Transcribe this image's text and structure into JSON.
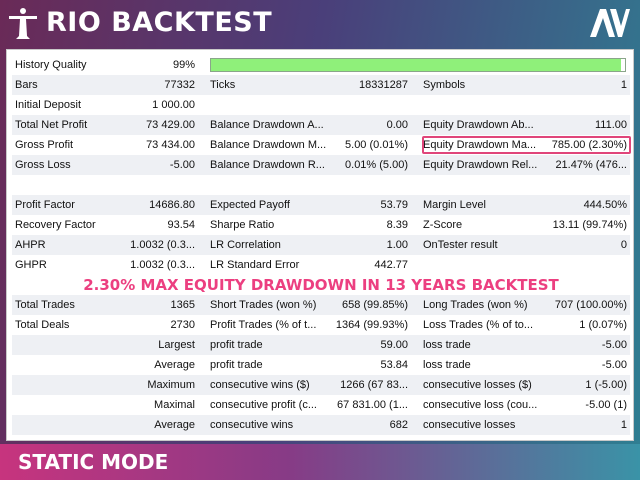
{
  "header": {
    "title": "RIO BACKTEST",
    "logo_text": "AV",
    "colors": {
      "accent": "#ec3f80",
      "bar_fill": "#8ff07a"
    }
  },
  "report": {
    "history_quality": {
      "label": "History Quality",
      "value": "99%",
      "fill_percent": 99
    },
    "rows": [
      {
        "c1": {
          "label": "Bars",
          "value": "77332"
        },
        "c2": {
          "label": "Ticks",
          "value": "18331287"
        },
        "c3": {
          "label": "Symbols",
          "value": "1"
        }
      },
      {
        "c1": {
          "label": "Initial Deposit",
          "value": "1 000.00"
        },
        "c2": {
          "label": "",
          "value": ""
        },
        "c3": {
          "label": "",
          "value": ""
        }
      },
      {
        "c1": {
          "label": "Total Net Profit",
          "value": "73 429.00"
        },
        "c2": {
          "label": "Balance Drawdown A...",
          "value": "0.00"
        },
        "c3": {
          "label": "Equity Drawdown Ab...",
          "value": "111.00"
        }
      },
      {
        "c1": {
          "label": "Gross Profit",
          "value": "73 434.00"
        },
        "c2": {
          "label": "Balance Drawdown M...",
          "value": "5.00 (0.01%)"
        },
        "c3": {
          "label": "Equity Drawdown Ma...",
          "value": "785.00 (2.30%)"
        }
      },
      {
        "c1": {
          "label": "Gross Loss",
          "value": "-5.00"
        },
        "c2": {
          "label": "Balance Drawdown R...",
          "value": "0.01% (5.00)"
        },
        "c3": {
          "label": "Equity Drawdown Rel...",
          "value": "21.47% (476..."
        }
      },
      {
        "c1": {
          "label": "",
          "value": ""
        },
        "c2": {
          "label": "",
          "value": ""
        },
        "c3": {
          "label": "",
          "value": ""
        }
      },
      {
        "c1": {
          "label": "Profit Factor",
          "value": "14686.80"
        },
        "c2": {
          "label": "Expected Payoff",
          "value": "53.79"
        },
        "c3": {
          "label": "Margin Level",
          "value": "444.50%"
        }
      },
      {
        "c1": {
          "label": "Recovery Factor",
          "value": "93.54"
        },
        "c2": {
          "label": "Sharpe Ratio",
          "value": "8.39"
        },
        "c3": {
          "label": "Z-Score",
          "value": "13.11 (99.74%)"
        }
      },
      {
        "c1": {
          "label": "AHPR",
          "value": "1.0032 (0.3..."
        },
        "c2": {
          "label": "LR Correlation",
          "value": "1.00"
        },
        "c3": {
          "label": "OnTester result",
          "value": "0"
        }
      },
      {
        "c1": {
          "label": "GHPR",
          "value": "1.0032 (0.3..."
        },
        "c2": {
          "label": "LR Standard Error",
          "value": "442.77"
        },
        "c3": {
          "label": "",
          "value": ""
        }
      }
    ],
    "banner": "2.30% MAX EQUITY DRAWDOWN IN 13 YEARS BACKTEST",
    "trade_rows": [
      {
        "c1": {
          "label": "Total Trades",
          "value": "1365"
        },
        "c2": {
          "label": "Short Trades (won %)",
          "value": "658 (99.85%)"
        },
        "c3": {
          "label": "Long Trades (won %)",
          "value": "707 (100.00%)"
        }
      },
      {
        "c1": {
          "label": "Total Deals",
          "value": "2730"
        },
        "c2": {
          "label": "Profit Trades (% of t...",
          "value": "1364 (99.93%)"
        },
        "c3": {
          "label": "Loss Trades (% of to...",
          "value": "1 (0.07%)"
        }
      },
      {
        "c1": {
          "label": "Largest",
          "value": ""
        },
        "c2": {
          "label": "profit trade",
          "value": "59.00"
        },
        "c3": {
          "label": "loss trade",
          "value": "-5.00"
        }
      },
      {
        "c1": {
          "label": "Average",
          "value": ""
        },
        "c2": {
          "label": "profit trade",
          "value": "53.84"
        },
        "c3": {
          "label": "loss trade",
          "value": "-5.00"
        }
      },
      {
        "c1": {
          "label": "Maximum",
          "value": ""
        },
        "c2": {
          "label": "consecutive wins ($)",
          "value": "1266 (67 83..."
        },
        "c3": {
          "label": "consecutive losses ($)",
          "value": "1 (-5.00)"
        }
      },
      {
        "c1": {
          "label": "Maximal",
          "value": ""
        },
        "c2": {
          "label": "consecutive profit (c...",
          "value": "67 831.00 (1..."
        },
        "c3": {
          "label": "consecutive loss (cou...",
          "value": "-5.00 (1)"
        }
      },
      {
        "c1": {
          "label": "Average",
          "value": ""
        },
        "c2": {
          "label": "consecutive wins",
          "value": "682"
        },
        "c3": {
          "label": "consecutive losses",
          "value": "1"
        }
      }
    ]
  },
  "footer": {
    "mode": "STATIC MODE"
  }
}
